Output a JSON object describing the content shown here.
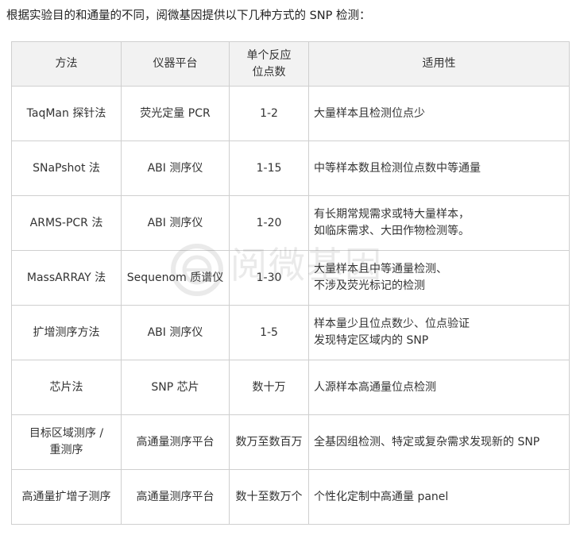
{
  "intro": "根据实验目的和通量的不同，阅微基因提供以下几种方式的 SNP 检测：",
  "table": {
    "headers": [
      [
        "方法"
      ],
      [
        "仪器平台"
      ],
      [
        "单个反应",
        "位点数"
      ],
      [
        "适用性"
      ]
    ],
    "rows": [
      {
        "method": [
          "TaqMan 探针法"
        ],
        "platform": [
          "荧光定量 PCR"
        ],
        "sites": "1-2",
        "usage": [
          "大量样本且检测位点少"
        ]
      },
      {
        "method": [
          "SNaPshot 法"
        ],
        "platform": [
          "ABI 测序仪"
        ],
        "sites": "1-15",
        "usage": [
          "中等样本数且检测位点数中等通量"
        ]
      },
      {
        "method": [
          "ARMS-PCR 法"
        ],
        "platform": [
          "ABI 测序仪"
        ],
        "sites": "1-20",
        "usage": [
          "有长期常规需求或特大量样本，",
          "如临床需求、大田作物检测等。"
        ]
      },
      {
        "method": [
          "MassARRAY 法"
        ],
        "platform": [
          "Sequenom 质谱仪"
        ],
        "sites": "1-30",
        "usage": [
          "大量样本且中等通量检测、",
          "不涉及荧光标记的检测"
        ]
      },
      {
        "method": [
          "扩增测序方法"
        ],
        "platform": [
          "ABI 测序仪"
        ],
        "sites": "1-5",
        "usage": [
          "样本量少且位点数少、位点验证",
          "发现特定区域内的 SNP"
        ]
      },
      {
        "method": [
          "芯片法"
        ],
        "platform": [
          "SNP 芯片"
        ],
        "sites": "数十万",
        "usage": [
          "人源样本高通量位点检测"
        ]
      },
      {
        "method": [
          "目标区域测序 /",
          "重测序"
        ],
        "platform": [
          "高通量测序平台"
        ],
        "sites": "数万至数百万",
        "usage": [
          "全基因组检测、特定或复杂需求发现新的 SNP"
        ]
      },
      {
        "method": [
          "高通量扩增子测序"
        ],
        "platform": [
          "高通量测序平台"
        ],
        "sites": "数十至数万个",
        "usage": [
          "个性化定制中高通量 panel"
        ]
      }
    ]
  },
  "watermark": {
    "text": "阅微基因"
  }
}
